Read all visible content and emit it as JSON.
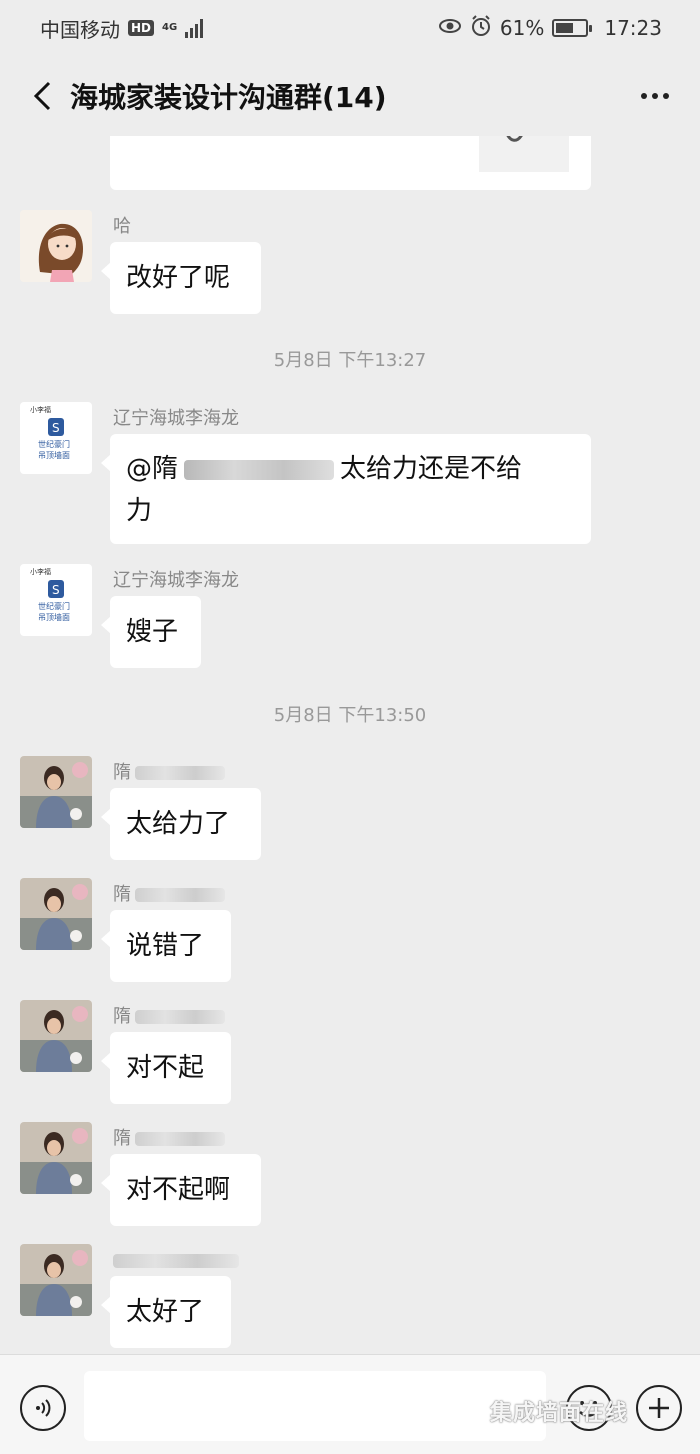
{
  "status_bar": {
    "carrier": "中国移动",
    "hd": "HD",
    "network": "4G",
    "battery_text": "61%",
    "battery_level": 0.61,
    "time": "17:23"
  },
  "header": {
    "title": "海城家装设计沟通群(14)"
  },
  "timestamps": [
    "5月8日 下午13:27",
    "5月8日 下午13:50"
  ],
  "messages": [
    {
      "sender": "哈",
      "text": "改好了呢"
    },
    {
      "sender": "辽宁海城李海龙",
      "text_prefix": "@隋",
      "text_line1": "太给力还是不给",
      "text_line2": "力"
    },
    {
      "sender": "辽宁海城李海龙",
      "text": "嫂子"
    },
    {
      "sender": "隋",
      "text": "太给力了"
    },
    {
      "sender": "隋",
      "text": "说错了"
    },
    {
      "sender": "隋",
      "text": "对不起"
    },
    {
      "sender": "隋",
      "text": "对不起啊"
    },
    {
      "sender": "",
      "text": "太好了"
    }
  ],
  "avatar_logo": {
    "top": "小李福",
    "letter": "S",
    "brand": "世纪豪门",
    "sub": "吊顶墙面"
  },
  "input_bar": {
    "watermark": "集成墙面在线"
  },
  "colors": {
    "background": "#ededed",
    "bubble": "#ffffff",
    "meta_text": "#888888"
  }
}
